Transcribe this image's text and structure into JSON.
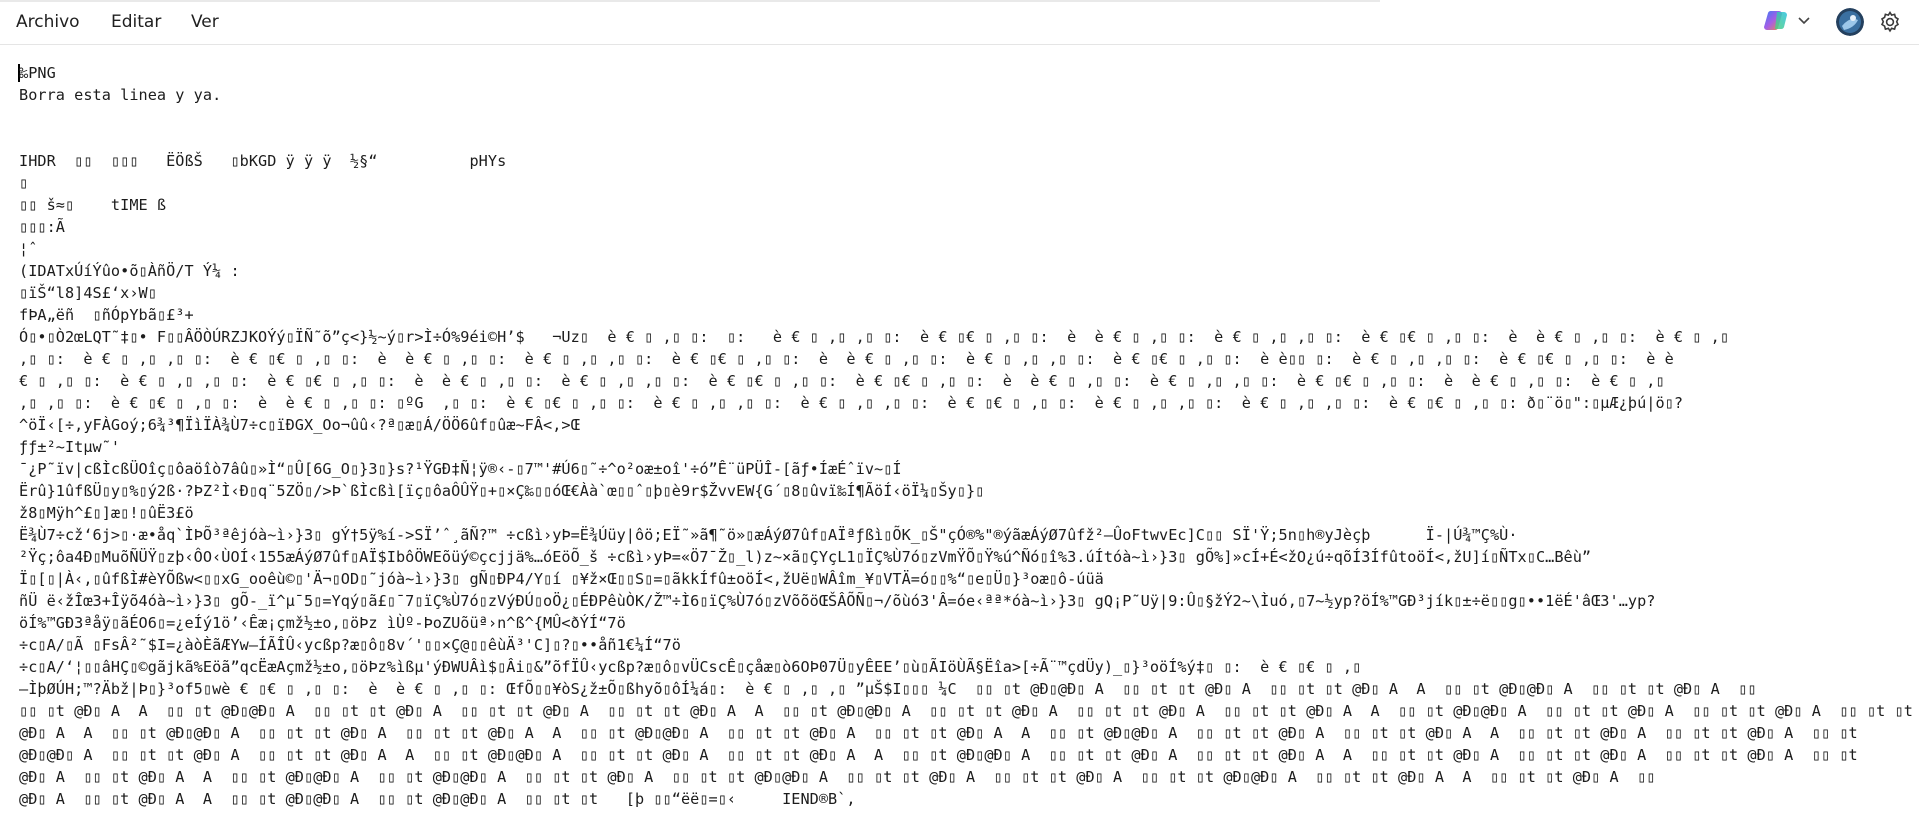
{
  "menu": {
    "items": [
      "Archivo",
      "Editar",
      "Ver"
    ]
  },
  "toolbar": {
    "copilot_icon": "copilot-icon",
    "chevron_icon": "chevron-down-icon",
    "avatar_icon": "avatar",
    "settings_icon": "gear-icon"
  },
  "colors": {
    "background": "#ffffff",
    "text": "#1c1c1c"
  },
  "editor": {
    "lines": [
      "‰PNG",
      "Borra esta linea y ya.",
      "",
      "",
      "IHDR  ▯▯  ▯▯▯   ËÖßŠ   ▯bKGD ÿ ÿ ÿ  ½§“          pHYs",
      "▯",
      "▯▯ š≈▯    tIME ß",
      "▯▯▯:Ã",
      "¦ˆ",
      "(IDATxÚíÝûo•õ▯ÀñÖ/T Ý¼ :",
      "▯ïŠ“l8]4S£‘x›W▯",
      "fÞA„ëñ  ▯ñÓpYbã▯£³+",
      "Ó▯•▯Ò2œLQT˜‡▯• F▯▯ÂÖÒÚRZJKOÝý▯ÏÑ˜õ”ç<}½~ý▯r>Ì÷Ó%9éi©H’$   ¬Uz▯  è € ▯ ,▯ ▯:  ▯:   è € ▯ ,▯ ,▯ ▯:  è € ▯€ ▯ ,▯ ▯:  è  è € ▯ ,▯ ▯:  è € ▯ ,▯ ,▯ ▯:  è € ▯€ ▯ ,▯ ▯:  è  è € ▯ ,▯ ▯:  è € ▯ ,▯",
      ",▯ ▯:  è € ▯ ,▯ ,▯ ▯:  è € ▯€ ▯ ,▯ ▯:  è  è € ▯ ,▯ ▯:  è € ▯ ,▯ ,▯ ▯:  è € ▯€ ▯ ,▯ ▯:  è  è € ▯ ,▯ ▯:  è € ▯ ,▯ ,▯ ▯:  è € ▯€ ▯ ,▯ ▯:  è è▯▯ ▯:  è € ▯ ,▯ ,▯ ▯:  è € ▯€ ▯ ,▯ ▯:  è è",
      "€ ▯ ,▯ ▯:  è € ▯ ,▯ ,▯ ▯:  è € ▯€ ▯ ,▯ ▯:  è  è € ▯ ,▯ ▯:  è € ▯ ,▯ ,▯ ▯:  è € ▯€ ▯ ,▯ ▯:  è € ▯€ ▯ ,▯ ▯:  è  è € ▯ ,▯ ▯:  è € ▯ ,▯ ,▯ ▯:  è € ▯€ ▯ ,▯ ▯:  è  è € ▯ ,▯ ▯:  è € ▯ ,▯",
      ",▯ ,▯ ▯:  è € ▯€ ▯ ,▯ ▯:  è  è € ▯ ,▯ ▯: ▯ºG  ,▯ ▯:  è € ▯€ ▯ ,▯ ▯:  è € ▯ ,▯ ,▯ ▯:  è € ▯ ,▯ ,▯ ▯:  è € ▯€ ▯ ,▯ ▯:  è € ▯ ,▯ ,▯ ▯:  è € ▯ ,▯ ,▯ ▯:  è € ▯€ ▯ ,▯ ▯: ð▯¨ö▯\":▯µÆ¿þú|ö▯?",
      "^öÏ‹[÷,yFÀGoý;6¾³¶ÏìÏÀ¾Ù7÷c▯ïÐGX_Oo¬ûû‹?ª▯æ▯Á/ÖÖ6ûf▯ûæ~FÂ<,>Œ",
      "ƒƒ±²~Itµw˜'",
      "¯¿P˜ïv|cßÌcßÜOîç▯ôaöîò7âû▯»Ì“▯Û[6G_O▯}3▯}s?¹ŸGÐ‡Ñ¦ÿ®‹-▯7™'#Ú6▯˜÷^o²oæ±oî'÷ó”Ê¨üPÜÎ-[ãƒ•ÍæÉˆïv~▯Í",
      "Ërû}1ûfßÜ▯y▯%▯ý2ß·?ÞZ²Ì‹Ð▯q¨5ZÖ▯/>Þ`ßÌcßì[ïç▯ôaÔÛŸ▯+▯×Ç‰▯▯óŒ€Àà`œ▯▯ˆ▯þ▯è9r$ŽvvEW{G´▯8▯ûvï‰Í¶ÃöÍ‹öÏ¼▯Šy▯}▯",
      "ž8▯Mÿh^£▯]æ▯!▯ûË3£ö",
      "Ë¾Ù7÷cž‘6j>▯·æ•åq`ÌÞÕ³ªêjóà~ì›}3▯ gÝ†5ÿ%í->SÏ’ˆ¸ãÑ?™ ÷cßì›yÞ=Ë¾Úüy|ôö;EÏ˜»ã¶˜ö»▯æÁýØ7ûf▯AÏªƒßì▯ÕK_▯Š\"çÓ®%\"®ýãæÁýØ7ûfž²—ÛoFtwvEc]C▯▯ SÏ'Ÿ;5n▯h®yJèçþ      Ï-|Ú¾™Ç%Ù·",
      "²Ÿç;ôa4Ð▯MuõÑÜŸ▯zþ‹ÔO‹ÙOÍ‹155æÁýØ7ûf▯AÏ$IbôÖWEõüý©çcjjä%…óEöÕ_š ÷cßì›yÞ=«Ö7¯Ž▯_l)z~×ã▯ÇYçL1▯ÏÇ%Ù7ó▯zVmŸÕ▯Ÿ%ú^Ñó▯î%3.úÍtóà~ì›}3▯ gÕ%]»cÍ+É<žO¿ú÷qõÍ3ÍfûtoöÍ<,žU]í▯ÑTx▯C…Bêù”",
      "Ï▯[▯|À‹,▯ûfßÌ#èYÕßw<▯▯xG_ooêù©▯'Ä¬▯OD▯˜jóà~ì›}3▯ gÑ▯ÐP4/Y▯í ▯¥ž×Œ▯▯S▯=▯ãkkÍfû±oöÍ<,žUë▯WÂîm_¥▯VTÄ=ó▯▯%“▯e▯Ü▯}³oæ▯ô-úüä",
      "ñÜ ë‹žÎœ3+Îÿõ4óà~ì›}3▯ gÕ-_ï^µ¯5▯=Yqý▯ã£▯¯7▯ïÇ%Ù7ó▯zVýÐÚ▯oÖ¿▯ÉÐPêùÒK/Ž™÷Ì6▯ïÇ%Ù7ó▯zVõõöŒŠÂÕÑ▯¬/õùó3'Â=óe‹ªª*óà~ì›}3▯ gQ¡P˜Uÿ|9:Û▯§žÝ2~\\Ìuó,▯7~½yp?öÍ%™GÐ³jík▯±÷ë▯▯g▯••1ëÉ'âŒ3'…yp?",
      "öÍ%™GÐ3ªåÿ▯ãÉO6▯=¿eÍý1ö’‹Êæ¡çmž½±o,▯öÞz ìÙº-ÞoZUõüª›n^ß^{MÛ<ðÝÍ“7ö",
      "÷c▯A/▯Ã ▯FsÂ²˜$I=¿àòÈãÆYw—ÍÃÎÛ‹ycßp?æ▯ô▯8v´'▯▯×Ç@▯▯êùÄ³'C]▯?▯••åñ1€¼Í“7ö",
      "÷c▯A/‘¦▯▯âHÇ▯©gãjkã%Eöã”qcËæAçmž½±o,▯öÞz%ìßµ'ýÐWUÂì$▯Âi▯&”õfÏÛ‹ycßp?æ▯ô▯vÜCscÊ▯çåæ▯ò6OÞ07Ü▯yÊEE’▯ù▯ÃIöÙÃ§Ëîa>[÷Ã¨™çdÜy)_▯}³oöÍ%ý‡▯ ▯:  è € ▯€ ▯ ,▯",
      "—ÌþØÚH;™?Äbž|Þ▯}³of5▯wè € ▯€ ▯ ,▯ ▯:  è  è € ▯ ,▯ ▯: ŒfÕ▯▯¥òS¿ž±Õ▯ßhyõ▯ôÍ¼á▯:  è € ▯ ,▯ ,▯ ”µŠ$I▯▯▯ ¼C  ▯▯ ▯t @Ð▯@Ð▯ A  ▯▯ ▯t ▯t @Ð▯ A  ▯▯ ▯t ▯t @Ð▯ A  A  ▯▯ ▯t @Ð▯@Ð▯ A  ▯▯ ▯t ▯t @Ð▯ A  ▯▯",
      "▯▯ ▯t @Ð▯ A  A  ▯▯ ▯t @Ð▯@Ð▯ A  ▯▯ ▯t ▯t @Ð▯ A  ▯▯ ▯t ▯t @Ð▯ A  ▯▯ ▯t ▯t @Ð▯ A  A  ▯▯ ▯t @Ð▯@Ð▯ A  ▯▯ ▯t ▯t @Ð▯ A  ▯▯ ▯t ▯t @Ð▯ A  ▯▯ ▯t ▯t @Ð▯ A  A  ▯▯ ▯t @Ð▯@Ð▯ A  ▯▯ ▯t ▯t @Ð▯ A  ▯▯ ▯t ▯t @Ð▯ A  ▯▯ ▯t ▯t @Ð▯ A  A  ▯▯ ▯t",
      "@Ð▯ A  A  ▯▯ ▯t @Ð▯@Ð▯ A  ▯▯ ▯t ▯t @Ð▯ A  ▯▯ ▯t ▯t @Ð▯ A  A  ▯▯ ▯t @Ð▯@Ð▯ A  ▯▯ ▯t ▯t @Ð▯ A  ▯▯ ▯t ▯t @Ð▯ A  A  ▯▯ ▯t @Ð▯@Ð▯ A  ▯▯ ▯t ▯t @Ð▯ A  ▯▯ ▯t ▯t @Ð▯ A  A  ▯▯ ▯t ▯t @Ð▯ A  ▯▯ ▯t ▯t @Ð▯ A  ▯▯ ▯t",
      "@Ð▯@Ð▯ A  ▯▯ ▯t ▯t @Ð▯ A  ▯▯ ▯t ▯t @Ð▯ A  A  ▯▯ ▯t @Ð▯@Ð▯ A  ▯▯ ▯t ▯t @Ð▯ A  ▯▯ ▯t ▯t @Ð▯ A  A  ▯▯ ▯t @Ð▯@Ð▯ A  ▯▯ ▯t ▯t @Ð▯ A  ▯▯ ▯t ▯t @Ð▯ A  A  ▯▯ ▯t ▯t @Ð▯ A  ▯▯ ▯t ▯t @Ð▯ A  ▯▯ ▯t ▯t @Ð▯ A  ▯▯ ▯t",
      "@Ð▯ A  ▯▯ ▯t @Ð▯ A  A  ▯▯ ▯t @Ð▯@Ð▯ A  ▯▯ ▯t @Ð▯@Ð▯ A  ▯▯ ▯t ▯t @Ð▯ A  ▯▯ ▯t ▯t @Ð▯@Ð▯ A  ▯▯ ▯t ▯t @Ð▯ A  ▯▯ ▯t ▯t @Ð▯ A  ▯▯ ▯t ▯t @Ð▯@Ð▯ A  ▯▯ ▯t ▯t @Ð▯ A  A  ▯▯ ▯t ▯t @Ð▯ A  ▯▯",
      "@Ð▯ A  ▯▯ ▯t @Ð▯ A  A  ▯▯ ▯t @Ð▯@Ð▯ A  ▯▯ ▯t @Ð▯@Ð▯ A  ▯▯ ▯t ▯t   [þ ▯▯“ëë▯=▯‹     IEND®B`,"
    ]
  }
}
